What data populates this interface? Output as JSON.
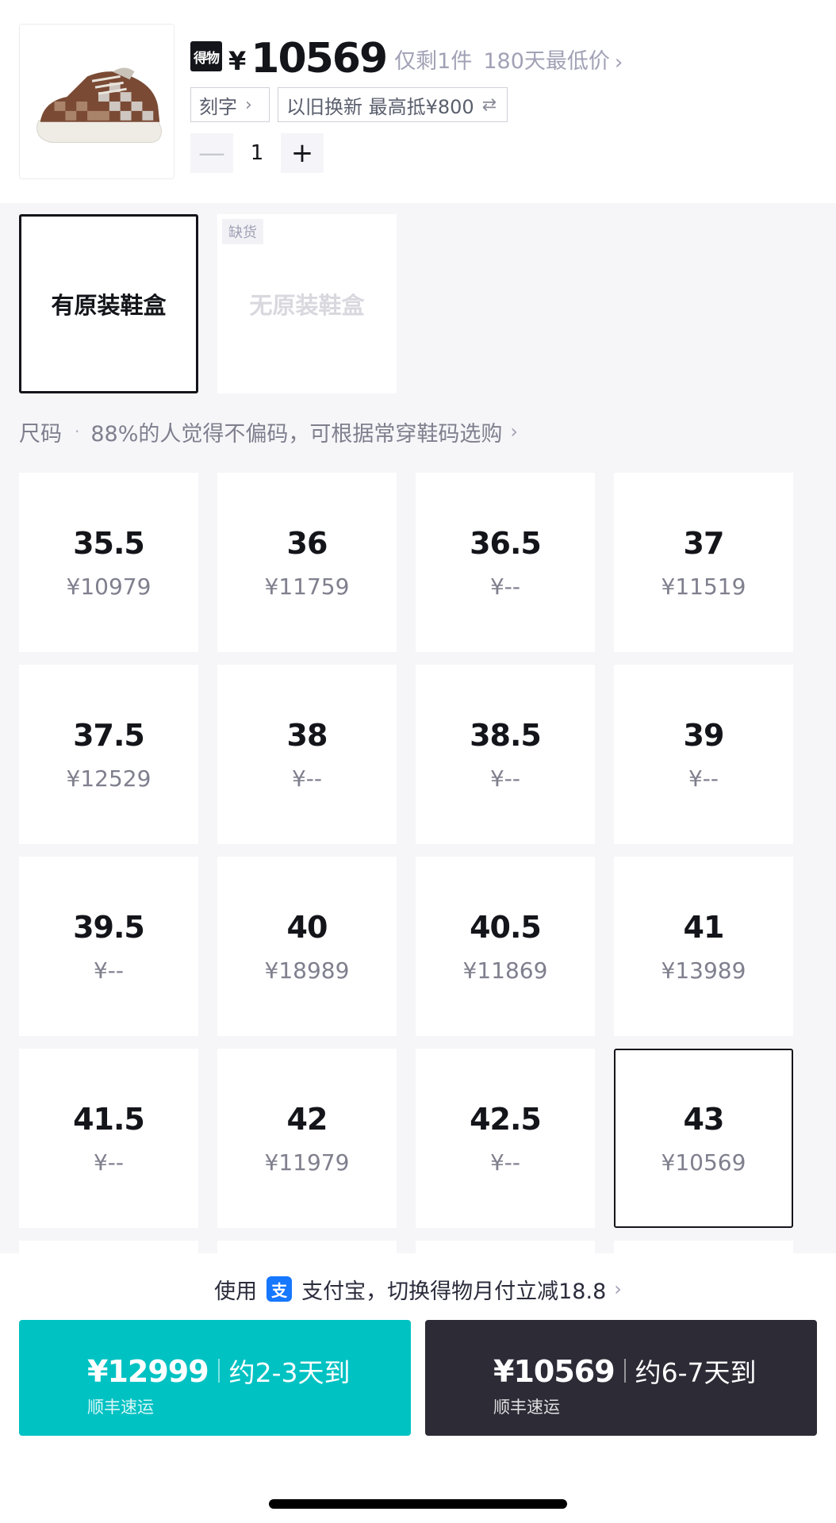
{
  "header": {
    "brand_badge": "得物",
    "currency": "¥",
    "price": "10569",
    "stock_note": "仅剩1件",
    "lowest_note": "180天最低价",
    "chevron": "›",
    "tags": {
      "engrave": "刻字",
      "tradein": "以旧换新 最高抵¥800",
      "tradein_icon": "⇄"
    },
    "quantity": {
      "minus": "—",
      "value": "1",
      "plus": "+"
    }
  },
  "box_options": {
    "with_box": "有原装鞋盒",
    "without_box": "无原装鞋盒",
    "out_of_stock": "缺货"
  },
  "size_hint": {
    "label": "尺码",
    "dot": "·",
    "text": "88%的人觉得不偏码，可根据常穿鞋码选购"
  },
  "sizes": [
    {
      "size": "35.5",
      "price": "¥10979"
    },
    {
      "size": "36",
      "price": "¥11759"
    },
    {
      "size": "36.5",
      "price": "¥--"
    },
    {
      "size": "37",
      "price": "¥11519"
    },
    {
      "size": "37.5",
      "price": "¥12529"
    },
    {
      "size": "38",
      "price": "¥--"
    },
    {
      "size": "38.5",
      "price": "¥--"
    },
    {
      "size": "39",
      "price": "¥--"
    },
    {
      "size": "39.5",
      "price": "¥--"
    },
    {
      "size": "40",
      "price": "¥18989"
    },
    {
      "size": "40.5",
      "price": "¥11869"
    },
    {
      "size": "41",
      "price": "¥13989"
    },
    {
      "size": "41.5",
      "price": "¥--"
    },
    {
      "size": "42",
      "price": "¥11979"
    },
    {
      "size": "42.5",
      "price": "¥--"
    },
    {
      "size": "43",
      "price": "¥10569"
    }
  ],
  "selected_size": "43",
  "payment_tip": {
    "prefix": "使用",
    "alipay_icon": "支",
    "text": "支付宝，切换得物月付立减18.8"
  },
  "buy_fast": {
    "price": "¥12999",
    "eta": "约2-3天到",
    "shipping": "顺丰速运"
  },
  "buy_slow": {
    "price": "¥10569",
    "eta": "约6-7天到",
    "shipping": "顺丰速运"
  },
  "colors": {
    "fast_button": "#01c2c3",
    "slow_button": "#2c2b36",
    "alipay": "#1677ff"
  }
}
